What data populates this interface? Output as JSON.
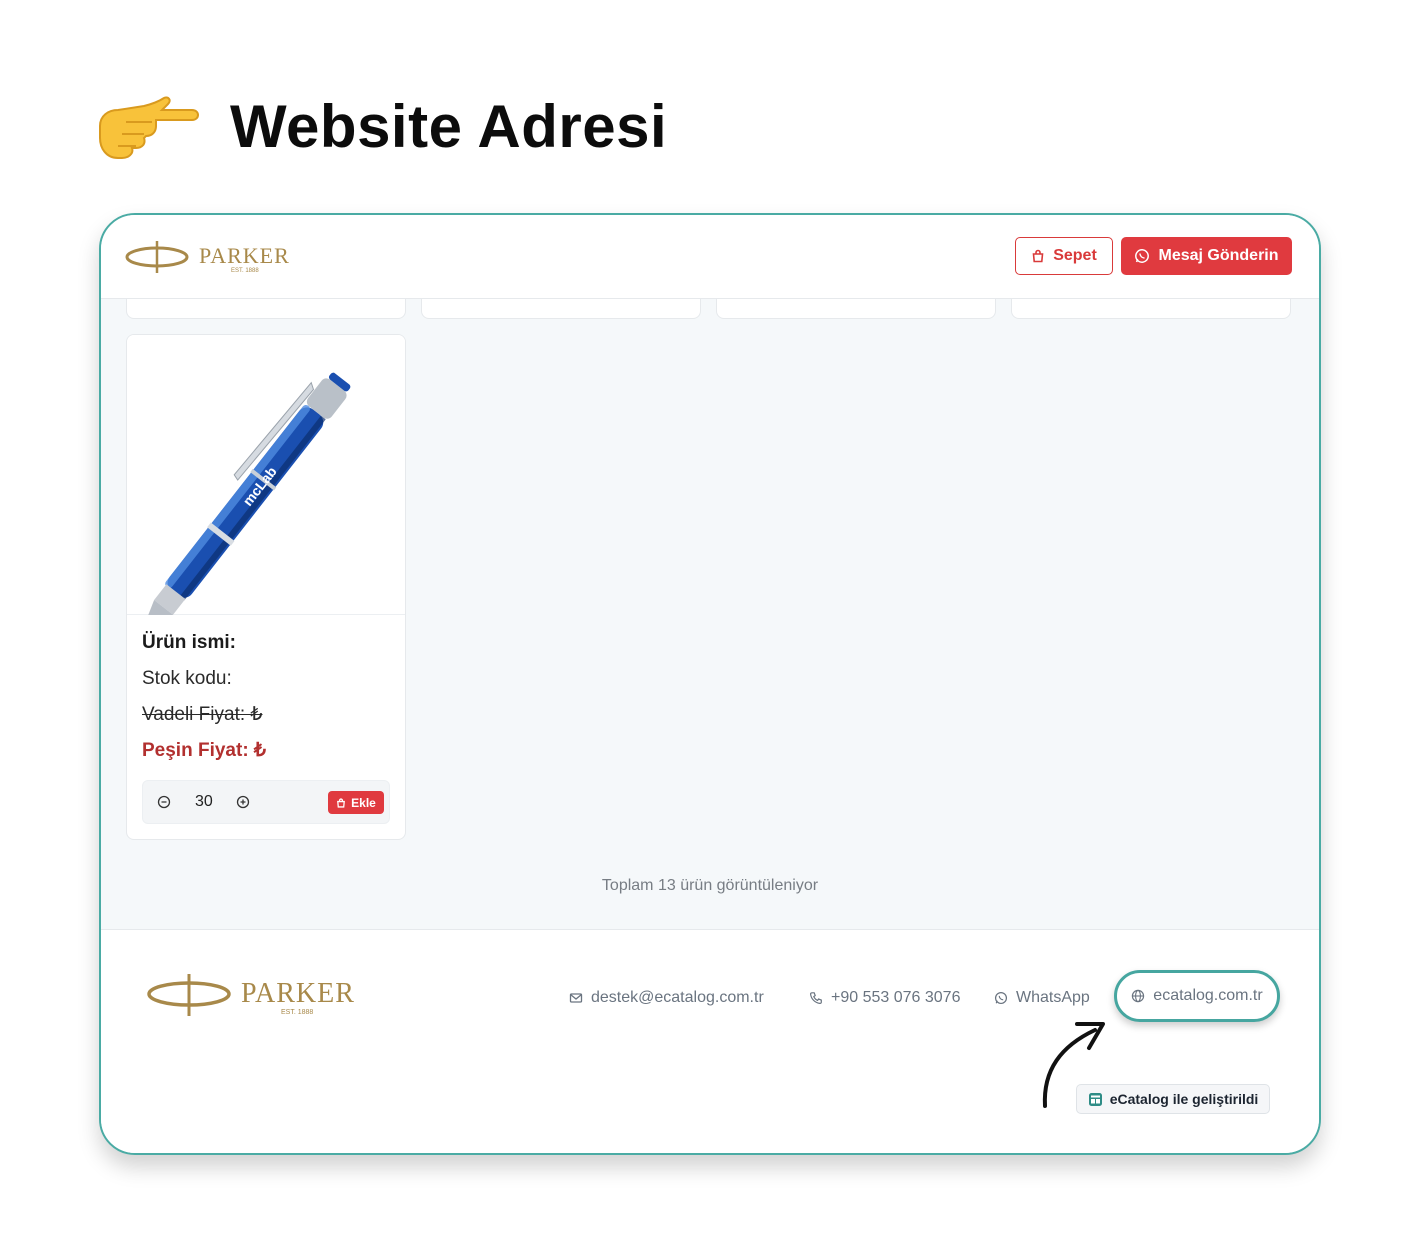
{
  "heading": {
    "icon": "pointing-hand-icon",
    "title": "Website Adresi"
  },
  "header": {
    "logo_text": "PARKER",
    "logo_sub": "EST. 1888",
    "cart_label": "Sepet",
    "message_label": "Mesaj Gönderin"
  },
  "product": {
    "name_label": "Ürün ismi:",
    "stock_label": "Stok kodu:",
    "deferred_price_label": "Vadeli Fiyat: ₺",
    "cash_price_label": "Peşin Fiyat: ₺",
    "quantity": "30",
    "add_label": "Ekle",
    "pen_text": "mcLab"
  },
  "listing": {
    "total_text": "Toplam 13 ürün görüntüleniyor"
  },
  "footer": {
    "logo_text": "PARKER",
    "logo_sub": "EST. 1888",
    "email": "destek@ecatalog.com.tr",
    "phone": "+90 553 076 3076",
    "whatsapp": "WhatsApp",
    "website": "ecatalog.com.tr",
    "powered_by": "eCatalog ile geliştirildi"
  },
  "colors": {
    "accent_red": "#e03a3f",
    "frame_teal": "#4aaba4",
    "gold": "#a8894a"
  }
}
